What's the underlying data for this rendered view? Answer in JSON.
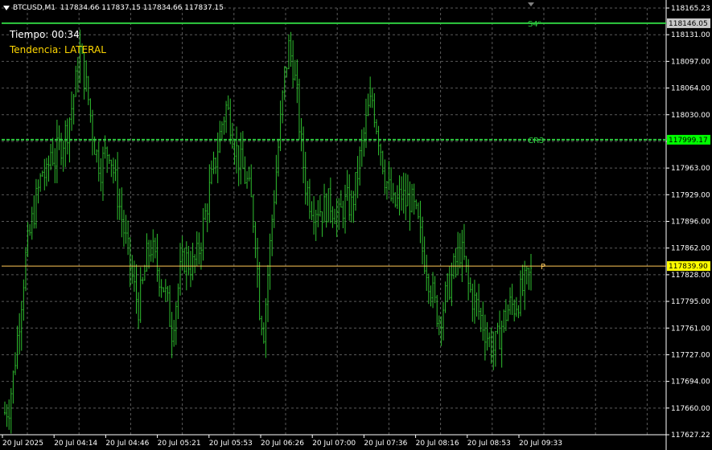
{
  "header": {
    "symbol": "BTCUSD,M1",
    "ohlc": "117834.66 117837.15 117834.66 117837.15"
  },
  "overlay": {
    "time_label": "Tiempo: 00:34",
    "trend_label": "Tendencia: LATERAL"
  },
  "colors": {
    "background": "#000000",
    "grid": "#5a5a5a",
    "candles": "#2fbf2f",
    "resistance_line": "#2ecc40",
    "pivot_line": "#ffc857",
    "axis_text": "#ffffff",
    "line_label": "#2ecc40",
    "price_marker_green": "#00ff00",
    "price_marker_yellow": "#ffff00"
  },
  "chart_data": {
    "type": "candlestick",
    "y_axis": {
      "min": 117627.22,
      "max": 118165.23,
      "ticks": [
        "118165.23",
        "118131.00",
        "118097.00",
        "118064.00",
        "118030.00",
        "117996.00",
        "117963.00",
        "117929.00",
        "117896.00",
        "117862.00",
        "117828.00",
        "117795.00",
        "117761.00",
        "117727.00",
        "117694.00",
        "117660.00",
        "117627.22"
      ]
    },
    "x_axis": {
      "labels": [
        "20 Jul 2025",
        "20 Jul 04:14",
        "20 Jul 04:46",
        "20 Jul 05:21",
        "20 Jul 05:53",
        "20 Jul 06:26",
        "20 Jul 07:00",
        "20 Jul 07:36",
        "20 Jul 08:16",
        "20 Jul 08:53",
        "20 Jul 09:33"
      ]
    },
    "grid": true,
    "levels": [
      {
        "name": "S4ⁿ",
        "price": 118146.05,
        "price_label": "118146.05",
        "style": "solid",
        "marker": "gray"
      },
      {
        "name": "CR3",
        "price": 117999.17,
        "price_label": "117999.17",
        "style": "dashed",
        "marker": "green"
      },
      {
        "name": "P",
        "price": 117839.9,
        "price_label": "117839.90",
        "style": "solid",
        "marker": "yellow"
      }
    ],
    "close_path": [
      [
        0,
        117655
      ],
      [
        2,
        117665
      ],
      [
        4,
        117700
      ],
      [
        6,
        117750
      ],
      [
        8,
        117800
      ],
      [
        10,
        117850
      ],
      [
        12,
        117880
      ],
      [
        14,
        117910
      ],
      [
        16,
        117935
      ],
      [
        18,
        117960
      ],
      [
        20,
        117950
      ],
      [
        22,
        117985
      ],
      [
        24,
        117975
      ],
      [
        26,
        117990
      ],
      [
        28,
        118000
      ],
      [
        30,
        118015
      ],
      [
        32,
        118040
      ],
      [
        34,
        118070
      ],
      [
        36,
        118110
      ],
      [
        38,
        118080
      ],
      [
        40,
        118050
      ],
      [
        42,
        118010
      ],
      [
        44,
        117980
      ],
      [
        46,
        117965
      ],
      [
        48,
        117980
      ],
      [
        50,
        117990
      ],
      [
        52,
        117960
      ],
      [
        54,
        117930
      ],
      [
        56,
        117900
      ],
      [
        58,
        117870
      ],
      [
        60,
        117840
      ],
      [
        62,
        117810
      ],
      [
        64,
        117790
      ],
      [
        66,
        117815
      ],
      [
        68,
        117850
      ],
      [
        70,
        117865
      ],
      [
        72,
        117845
      ],
      [
        74,
        117830
      ],
      [
        76,
        117815
      ],
      [
        78,
        117790
      ],
      [
        80,
        117760
      ],
      [
        82,
        117795
      ],
      [
        84,
        117830
      ],
      [
        86,
        117850
      ],
      [
        88,
        117845
      ],
      [
        90,
        117840
      ],
      [
        92,
        117850
      ],
      [
        94,
        117875
      ],
      [
        96,
        117905
      ],
      [
        98,
        117935
      ],
      [
        100,
        117960
      ],
      [
        102,
        117990
      ],
      [
        104,
        118020
      ],
      [
        106,
        118040
      ],
      [
        108,
        118025
      ],
      [
        110,
        117995
      ],
      [
        112,
        117975
      ],
      [
        114,
        117960
      ],
      [
        116,
        117945
      ],
      [
        118,
        117920
      ],
      [
        120,
        117880
      ],
      [
        122,
        117790
      ],
      [
        124,
        117760
      ],
      [
        126,
        117830
      ],
      [
        128,
        117900
      ],
      [
        130,
        117960
      ],
      [
        132,
        118020
      ],
      [
        134,
        118080
      ],
      [
        136,
        118115
      ],
      [
        138,
        118095
      ],
      [
        140,
        118050
      ],
      [
        142,
        117990
      ],
      [
        144,
        117945
      ],
      [
        146,
        117925
      ],
      [
        148,
        117915
      ],
      [
        150,
        117915
      ],
      [
        152,
        117910
      ],
      [
        154,
        117915
      ],
      [
        156,
        117920
      ],
      [
        158,
        117910
      ],
      [
        160,
        117900
      ],
      [
        162,
        117915
      ],
      [
        164,
        117920
      ],
      [
        166,
        117915
      ],
      [
        168,
        117940
      ],
      [
        170,
        117975
      ],
      [
        172,
        118005
      ],
      [
        174,
        118035
      ],
      [
        176,
        118050
      ],
      [
        178,
        118020
      ],
      [
        180,
        117990
      ],
      [
        182,
        117955
      ],
      [
        184,
        117935
      ],
      [
        186,
        117915
      ],
      [
        188,
        117920
      ],
      [
        190,
        117930
      ],
      [
        192,
        117920
      ],
      [
        194,
        117925
      ],
      [
        196,
        117910
      ],
      [
        198,
        117890
      ],
      [
        200,
        117860
      ],
      [
        202,
        117840
      ],
      [
        204,
        117815
      ],
      [
        206,
        117790
      ],
      [
        208,
        117775
      ],
      [
        210,
        117790
      ],
      [
        212,
        117810
      ],
      [
        214,
        117825
      ],
      [
        216,
        117845
      ],
      [
        218,
        117860
      ],
      [
        220,
        117845
      ],
      [
        222,
        117815
      ],
      [
        224,
        117800
      ],
      [
        226,
        117790
      ],
      [
        228,
        117775
      ],
      [
        230,
        117760
      ],
      [
        232,
        117745
      ],
      [
        234,
        117735
      ],
      [
        236,
        117745
      ],
      [
        238,
        117765
      ],
      [
        240,
        117780
      ],
      [
        242,
        117790
      ],
      [
        244,
        117790
      ],
      [
        246,
        117800
      ],
      [
        248,
        117810
      ],
      [
        250,
        117820
      ],
      [
        252,
        117830
      ]
    ],
    "x_range": [
      0,
      252
    ]
  }
}
